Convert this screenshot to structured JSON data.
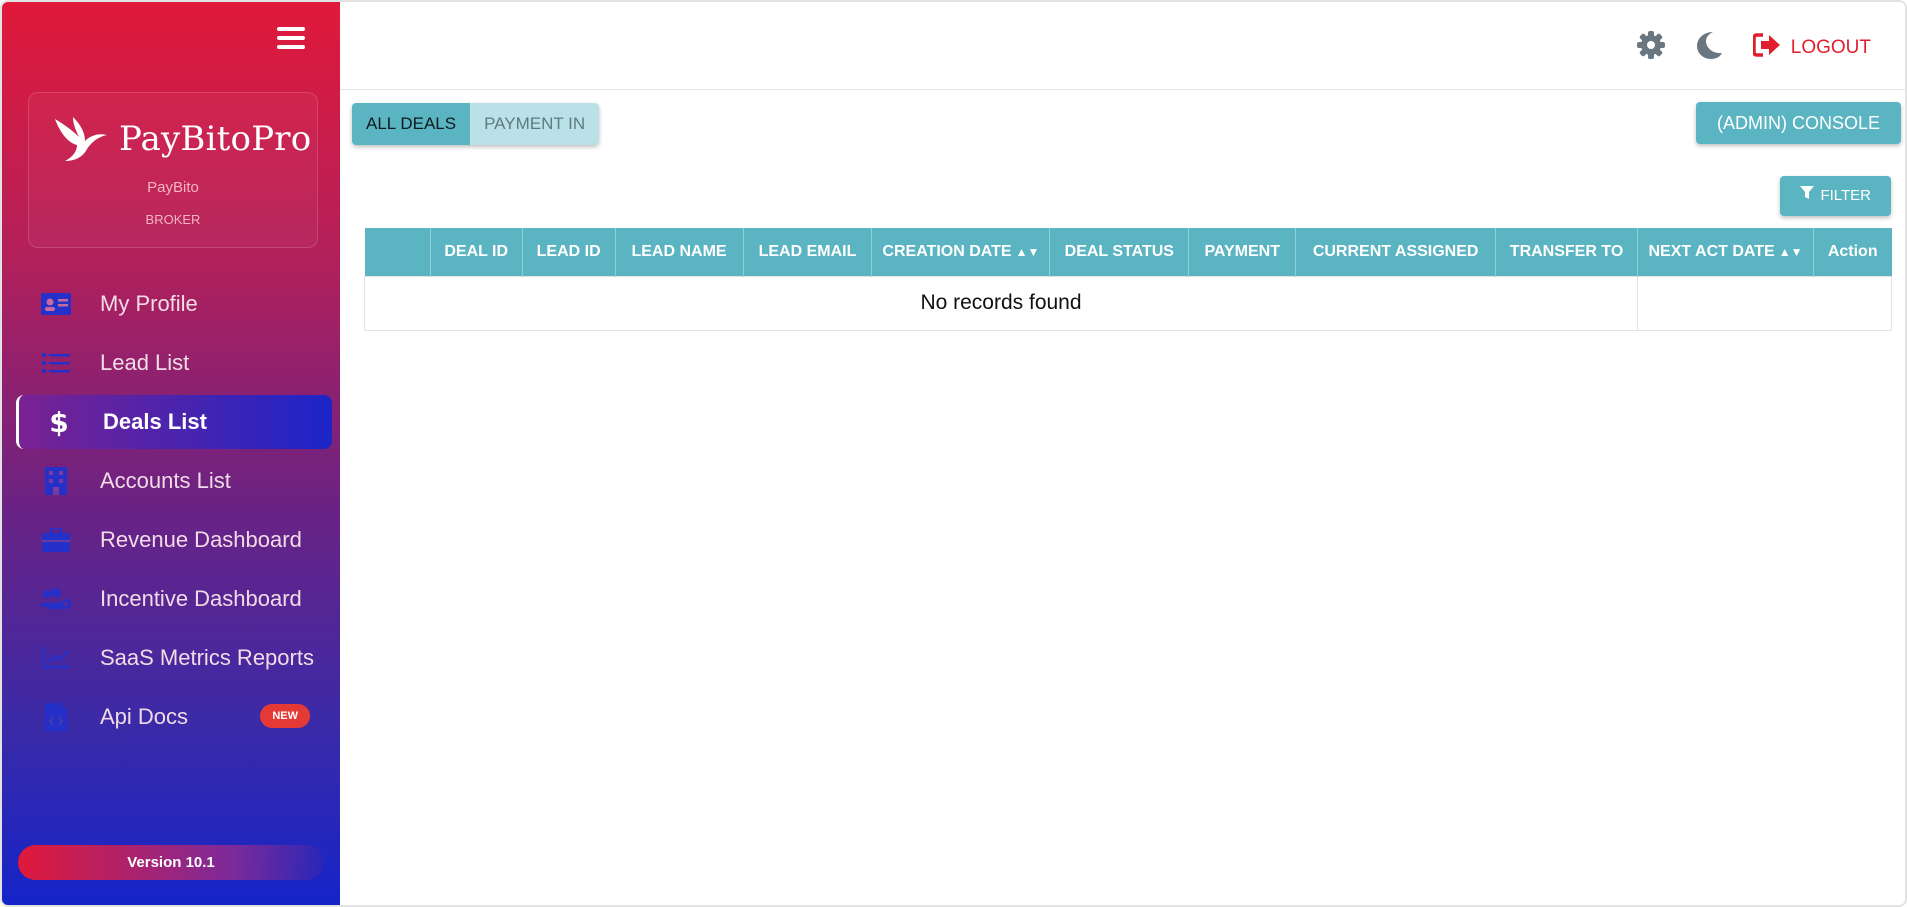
{
  "sidebar": {
    "brand_name": "PayBitoPro",
    "brand_sub": "PayBito",
    "brand_role": "BROKER",
    "items": [
      {
        "label": "My Profile",
        "icon": "id-card-icon"
      },
      {
        "label": "Lead List",
        "icon": "list-icon"
      },
      {
        "label": "Deals List",
        "icon": "dollar-icon",
        "active": true
      },
      {
        "label": "Accounts List",
        "icon": "building-icon"
      },
      {
        "label": "Revenue Dashboard",
        "icon": "briefcase-icon"
      },
      {
        "label": "Incentive Dashboard",
        "icon": "users-cog-icon"
      },
      {
        "label": "SaaS Metrics Reports",
        "icon": "chart-line-icon"
      },
      {
        "label": "Api Docs",
        "icon": "file-code-icon",
        "badge": "NEW"
      }
    ],
    "version": "Version 10.1"
  },
  "topbar": {
    "logout_label": "LOGOUT"
  },
  "main": {
    "tabs": [
      {
        "label": "ALL DEALS",
        "active": true
      },
      {
        "label": "PAYMENT IN",
        "active": false
      }
    ],
    "console_label": "(ADMIN) CONSOLE",
    "filter_label": "FILTER",
    "table": {
      "columns": [
        "",
        "DEAL ID",
        "LEAD ID",
        "LEAD NAME",
        "LEAD EMAIL",
        "CREATION DATE",
        "DEAL STATUS",
        "PAYMENT",
        "CURRENT ASSIGNED",
        "TRANSFER TO",
        "NEXT ACT DATE",
        "Action"
      ],
      "empty_message": "No records found"
    }
  },
  "colors": {
    "accent": "#5bb4c2",
    "logout": "#e01e2e",
    "nav_icon": "#2430c8"
  }
}
